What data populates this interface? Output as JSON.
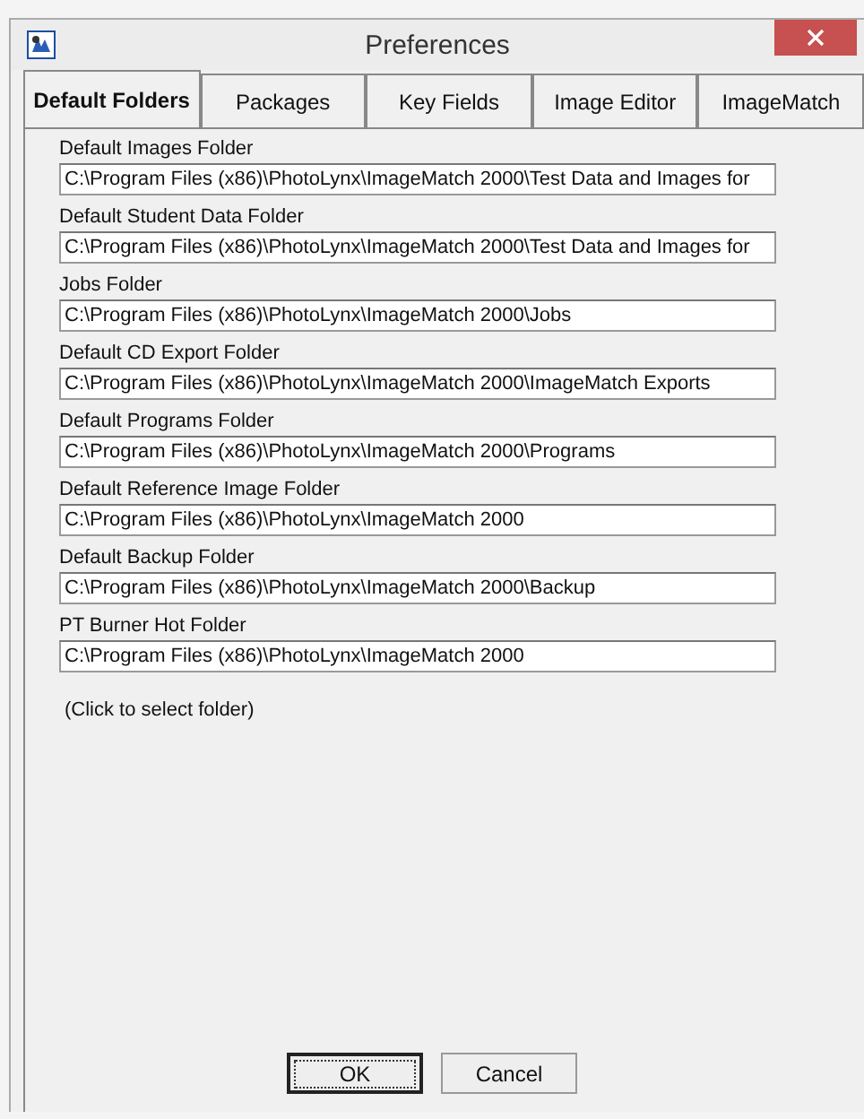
{
  "window": {
    "title": "Preferences"
  },
  "tabs": [
    {
      "label": "Default Folders",
      "selected": true
    },
    {
      "label": "Packages",
      "selected": false
    },
    {
      "label": "Key Fields",
      "selected": false
    },
    {
      "label": "Image Editor",
      "selected": false
    },
    {
      "label": "ImageMatch",
      "selected": false
    }
  ],
  "folders": [
    {
      "label": "Default Images Folder",
      "value": "C:\\Program Files (x86)\\PhotoLynx\\ImageMatch 2000\\Test Data and Images for"
    },
    {
      "label": "Default Student Data Folder",
      "value": "C:\\Program Files (x86)\\PhotoLynx\\ImageMatch 2000\\Test Data and Images for"
    },
    {
      "label": "Jobs Folder",
      "value": "C:\\Program Files (x86)\\PhotoLynx\\ImageMatch 2000\\Jobs"
    },
    {
      "label": "Default CD Export Folder",
      "value": "C:\\Program Files (x86)\\PhotoLynx\\ImageMatch 2000\\ImageMatch Exports"
    },
    {
      "label": "Default Programs Folder",
      "value": "C:\\Program Files (x86)\\PhotoLynx\\ImageMatch 2000\\Programs"
    },
    {
      "label": "Default Reference Image Folder",
      "value": "C:\\Program Files (x86)\\PhotoLynx\\ImageMatch 2000"
    },
    {
      "label": "Default Backup Folder",
      "value": "C:\\Program Files (x86)\\PhotoLynx\\ImageMatch 2000\\Backup"
    },
    {
      "label": "PT Burner Hot Folder",
      "value": "C:\\Program Files (x86)\\PhotoLynx\\ImageMatch 2000"
    }
  ],
  "hint": "(Click to select folder)",
  "buttons": [
    {
      "label": "OK",
      "default": true
    },
    {
      "label": "Cancel",
      "default": false
    }
  ]
}
